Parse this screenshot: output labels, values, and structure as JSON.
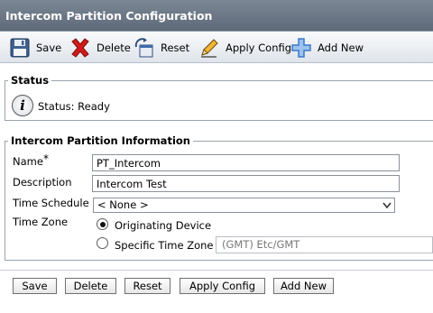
{
  "title": "Intercom Partition Configuration",
  "toolbar": {
    "save": "Save",
    "delete": "Delete",
    "reset": "Reset",
    "apply_config": "Apply Config",
    "add_new": "Add New"
  },
  "status": {
    "legend": "Status",
    "text": "Status: Ready"
  },
  "info": {
    "legend": "Intercom Partition Information",
    "name_label": "Name",
    "required_mark": "*",
    "name_value": "PT_Intercom",
    "description_label": "Description",
    "description_value": "Intercom Test",
    "time_schedule_label": "Time Schedule",
    "time_schedule_value": "< None >",
    "time_zone_label": "Time Zone",
    "originating_device": "Originating Device",
    "specific_time_zone": "Specific Time Zone",
    "specific_time_zone_value": "(GMT) Etc/GMT"
  },
  "bottom_buttons": {
    "save": "Save",
    "delete": "Delete",
    "reset": "Reset",
    "apply_config": "Apply Config",
    "add_new": "Add New"
  },
  "colors": {
    "titlebar": "#6b7786",
    "delete_icon": "#d21a1a",
    "add_icon": "#3a78c8"
  }
}
